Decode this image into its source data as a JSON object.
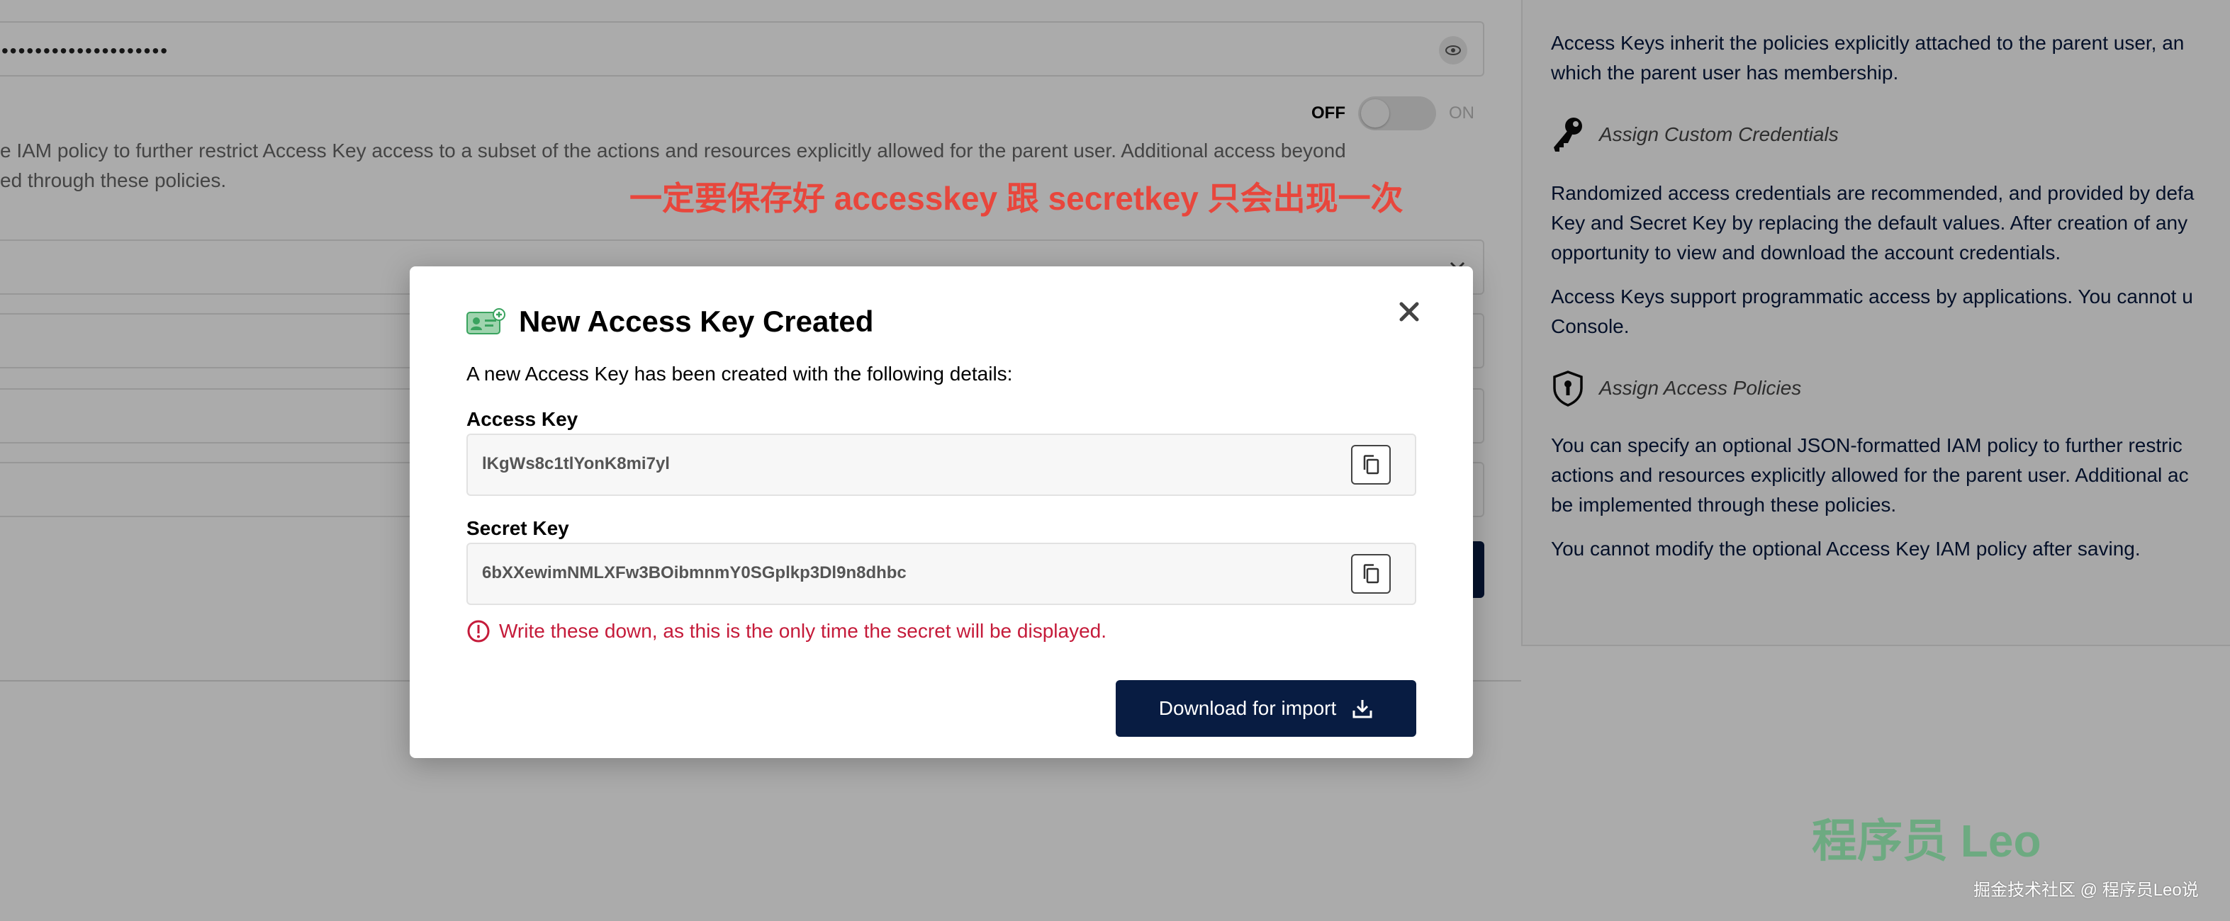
{
  "background": {
    "password_mask": "••••••••••••••••••••",
    "toggle": {
      "off_label": "OFF",
      "on_label": "ON"
    },
    "policy_text_line1": "e IAM policy to further restrict Access Key access to a subset of the actions and resources explicitly allowed for the parent user. Additional access beyond",
    "policy_text_line2": "ed through these policies."
  },
  "annotation": "一定要保存好 accesskey 跟 secretkey 只会出现一次",
  "sidebar": {
    "p1_line1": "Access Keys inherit the policies explicitly attached to the parent user, an",
    "p1_line2": "which the parent user has membership.",
    "heading1": "Assign Custom Credentials",
    "p2_line1": "Randomized access credentials are recommended, and provided by defa",
    "p2_line2": "Key and Secret Key by replacing the default values. After creation of any",
    "p2_line3": "opportunity to view and download the account credentials.",
    "p3_line1": "Access Keys support programmatic access by applications. You cannot u",
    "p3_line2": "Console.",
    "heading2": "Assign Access Policies",
    "p4_line1": "You can specify an optional JSON-formatted IAM policy to further restric",
    "p4_line2": "actions and resources explicitly allowed for the parent user. Additional ac",
    "p4_line3": "be implemented through these policies.",
    "p5": "You cannot modify the optional Access Key IAM policy after saving."
  },
  "modal": {
    "title": "New Access Key Created",
    "description": "A new Access Key has been created with the following details:",
    "access_key_label": "Access Key",
    "access_key_value": "lKgWs8c1tlYonK8mi7yl",
    "secret_key_label": "Secret Key",
    "secret_key_value": "6bXXewimNMLXFw3BOibmnmY0SGplkp3Dl9n8dhbc",
    "warning": "Write these down, as this is the only time the secret will be displayed.",
    "download_label": "Download for import"
  },
  "watermark": "程序员 Leo",
  "credit": "掘金技术社区 @ 程序员Leo说",
  "colors": {
    "primary_dark": "#081c42",
    "warning_red": "#c51b3a",
    "annotation_red": "#e8463c",
    "icon_green": "#3aa35f"
  }
}
